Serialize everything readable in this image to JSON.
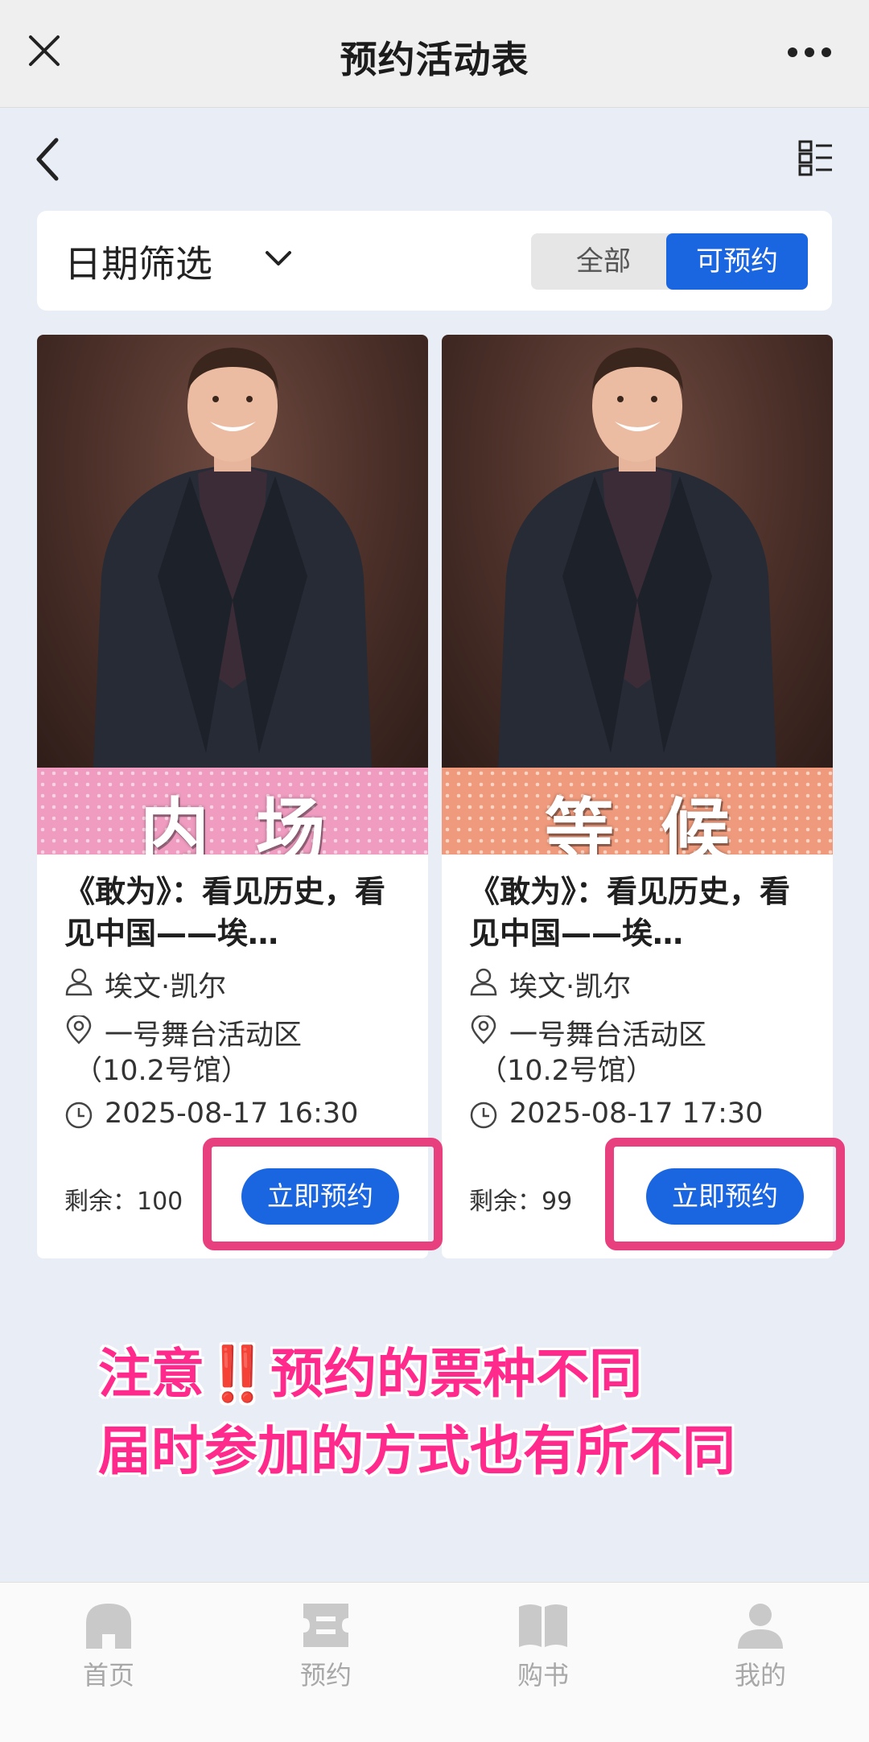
{
  "header": {
    "title": "预约活动表"
  },
  "filter": {
    "date_label": "日期筛选",
    "all_label": "全部",
    "available_label": "可预约"
  },
  "cards": [
    {
      "banner": "内场券",
      "title": "《敢为》：看见历史，看见中国——埃…",
      "speaker": "埃文·凯尔",
      "location_line1": "一号舞台活动区",
      "location_line2": "（10.2号馆）",
      "time": "2025-08-17 16:30",
      "remain_label": "剩余：",
      "remain_value": "100",
      "button": "立即预约"
    },
    {
      "banner": "等候券",
      "title": "《敢为》：看见历史，看见中国——埃…",
      "speaker": "埃文·凯尔",
      "location_line1": "一号舞台活动区",
      "location_line2": "（10.2号馆）",
      "time": "2025-08-17 17:30",
      "remain_label": "剩余：",
      "remain_value": "99",
      "button": "立即预约"
    }
  ],
  "note": {
    "line1_a": "注意",
    "line1_bang": "‼️",
    "line1_b": "预约的票种不同",
    "line2": "届时参加的方式也有所不同"
  },
  "tabs": [
    {
      "label": "首页",
      "icon": "home-icon"
    },
    {
      "label": "预约",
      "icon": "ticket-icon"
    },
    {
      "label": "购书",
      "icon": "book-icon"
    },
    {
      "label": "我的",
      "icon": "user-icon"
    }
  ],
  "colors": {
    "accent": "#1a66e0",
    "highlight": "#e8407e",
    "note": "#ff2a8c"
  }
}
